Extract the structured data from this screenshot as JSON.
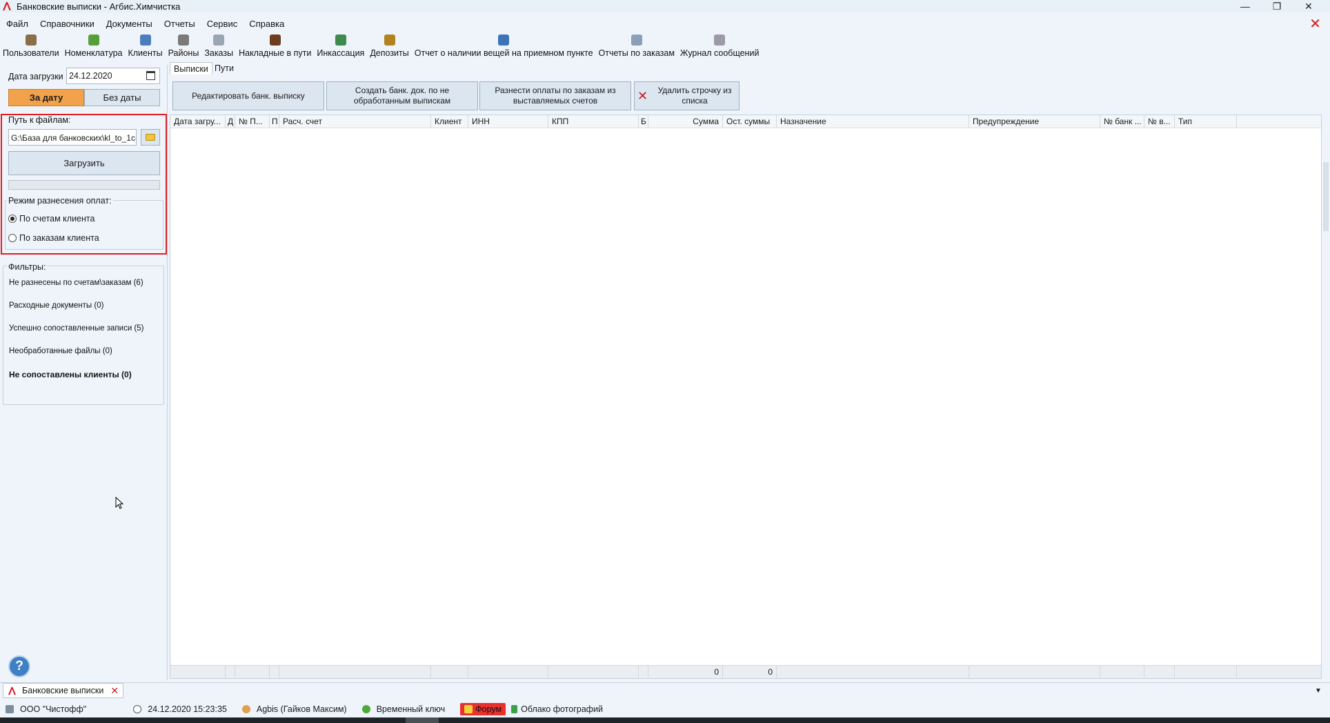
{
  "window": {
    "title": "Банковские выписки - Агбис.Химчистка",
    "controls": {
      "minimize": "—",
      "restore": "❐",
      "close": "✕"
    }
  },
  "menu": {
    "items": [
      "Файл",
      "Справочники",
      "Документы",
      "Отчеты",
      "Сервис",
      "Справка"
    ],
    "close_doc": "✕"
  },
  "toolbar": {
    "items": [
      {
        "label": "Пользователи",
        "icon": "users-icon",
        "color": "#8a6e4a"
      },
      {
        "label": "Номенклатура",
        "icon": "nomenclature-icon",
        "color": "#5a9e3a"
      },
      {
        "label": "Клиенты",
        "icon": "clients-icon",
        "color": "#4c7dbf"
      },
      {
        "label": "Районы",
        "icon": "districts-icon",
        "color": "#7a7a7a"
      },
      {
        "label": "Заказы",
        "icon": "orders-icon",
        "color": "#9aa6b2"
      },
      {
        "label": "Накладные в пути",
        "icon": "waybills-icon",
        "color": "#6b3d1e"
      },
      {
        "label": "Инкассация",
        "icon": "collection-icon",
        "color": "#3f8a4e"
      },
      {
        "label": "Депозиты",
        "icon": "deposits-icon",
        "color": "#b0831f"
      },
      {
        "label": "Отчет о наличии вещей на приемном пункте",
        "icon": "items-report-icon",
        "color": "#3d74b8"
      },
      {
        "label": "Отчеты по заказам",
        "icon": "order-reports-icon",
        "color": "#8aa0b8"
      },
      {
        "label": "Журнал сообщений",
        "icon": "message-log-icon",
        "color": "#9a9aa8"
      }
    ]
  },
  "left_panel": {
    "load_date_label": "Дата загрузки",
    "load_date_value": "24.12.2020",
    "by_date_button": "За дату",
    "no_date_button": "Без даты",
    "path_label": "Путь к файлам:",
    "path_value": "G:\\База для банковских\\kl_to_1c-",
    "load_button": "Загрузить",
    "progress": 0,
    "mode_legend": "Режим разнесения оплат:",
    "mode_options": [
      {
        "label": "По счетам клиента",
        "selected": true
      },
      {
        "label": "По заказам клиента",
        "selected": false
      }
    ],
    "filters_legend": "Фильтры:",
    "filters": [
      {
        "label": "Не разнесены по счетам\\заказам (6)",
        "bold": false
      },
      {
        "label": "Расходные документы (0)",
        "bold": false
      },
      {
        "label": "Успешно сопоставленные записи (5)",
        "bold": false
      },
      {
        "label": "Необработанные файлы (0)",
        "bold": false
      },
      {
        "label": "Не сопоставлены клиенты (0)",
        "bold": true
      }
    ],
    "help": "?"
  },
  "tabs": {
    "statements": "Выписки",
    "paths": "Пути"
  },
  "actions": {
    "edit": "Редактировать банк. выписку",
    "create": "Создать банк. док. по не обработанным выпискам",
    "distribute": "Разнести оплаты по заказам из выставляемых счетов",
    "delete": "Удалить строчку из списка"
  },
  "grid": {
    "columns": [
      "Дата загру...",
      "Д",
      "№ П...",
      "П",
      "Расч. счет",
      "Клиент",
      "ИНН",
      "КПП",
      "Б",
      "Сумма",
      "Ост. суммы",
      "Назначение",
      "Предупреждение",
      "№ банк ...",
      "№ в...",
      "Тип"
    ],
    "footer": {
      "sum_total": "0",
      "remaining_total": "0"
    }
  },
  "doc_tabs": [
    {
      "label": "Банковские выписки",
      "close": "✕"
    }
  ],
  "statusbar": {
    "company": "ООО \"Чистофф\"",
    "datetime": "24.12.2020 15:23:35",
    "user": "Agbis (Гайков Максим)",
    "key": "Временный ключ",
    "forum": "Форум",
    "cloud": "Облако фотографий"
  },
  "colors": {
    "accent": "#f2a24a",
    "highlight_box": "#e01e22",
    "close_red": "#d01818",
    "forum_red": "#e8312f"
  }
}
